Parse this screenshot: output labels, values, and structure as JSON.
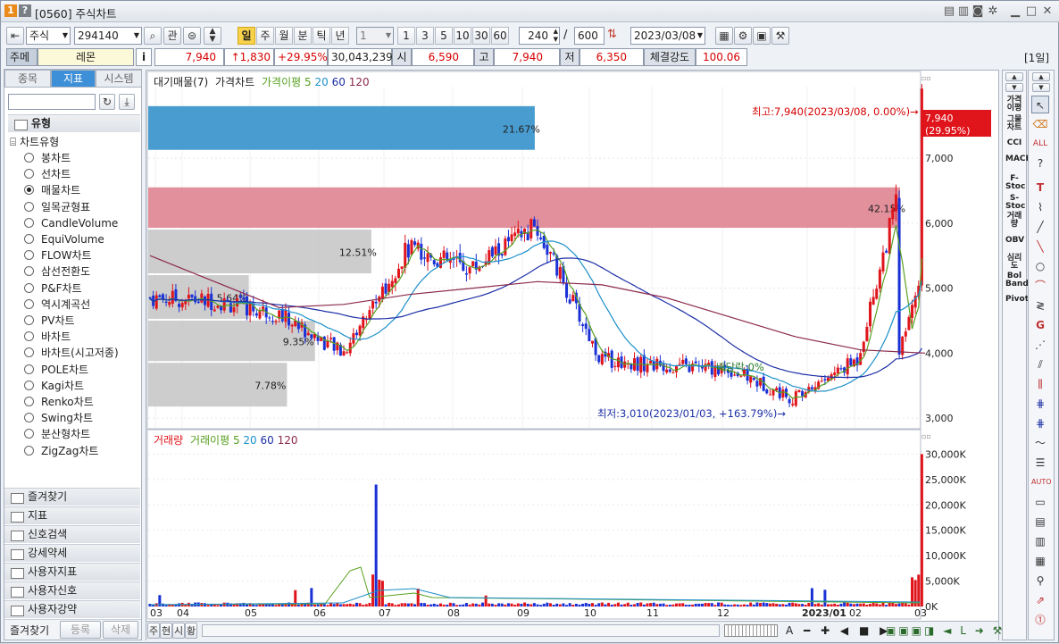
{
  "window": {
    "badge1": "1",
    "badge2": "?",
    "title": "[0560] 주식차트"
  },
  "toolbar1": {
    "market": "주식",
    "code": "294140",
    "btn_gwan": "관",
    "periods": [
      "일",
      "주",
      "월",
      "분",
      "틱",
      "년"
    ],
    "period_n": "1",
    "quick_n": [
      "1",
      "3",
      "5",
      "10",
      "30",
      "60"
    ],
    "view_count": "240",
    "slash": "/",
    "total_count": "600",
    "date": "2023/03/08"
  },
  "toolbar2": {
    "stock_type": "주메",
    "stock_name": "레몬",
    "info": "i",
    "price": "7,940",
    "change": "↑1,830",
    "rate": "+29.95%",
    "volume": "30,043,239",
    "open_label": "시",
    "open": "6,590",
    "high_label": "고",
    "high": "7,940",
    "low_label": "저",
    "low": "6,350",
    "strength_label": "체결강도",
    "strength": "100.06",
    "period_tag": "[1일]"
  },
  "leftpanel": {
    "tabs": [
      "종목",
      "지표",
      "시스템"
    ],
    "section": "유형",
    "group": "차트유형",
    "chart_types": [
      "봉차트",
      "선차트",
      "매물차트",
      "일목균형표",
      "CandleVolume",
      "EquiVolume",
      "FLOW차트",
      "삼선전환도",
      "P&F차트",
      "역시계곡선",
      "PV차트",
      "바차트",
      "바차트(시고저종)",
      "POLE차트",
      "Kagi차트",
      "Renko차트",
      "Swing차트",
      "분산형차트",
      "ZigZag차트"
    ],
    "selected": "매물차트",
    "folders": [
      "즐겨찾기",
      "지표",
      "신호검색",
      "강세약세",
      "사용자지표",
      "사용자신호",
      "사용자강약"
    ],
    "bottom_buttons": [
      "즐겨찾기",
      "등록",
      "삭제"
    ]
  },
  "price_legend": {
    "vp": "대기매물(7)",
    "price": "가격차트",
    "ma_label": "가격이평",
    "ma": [
      "5",
      "20",
      "60",
      "120"
    ]
  },
  "volume_legend": {
    "vol": "거래량",
    "ma_label": "거래이평",
    "ma": [
      "5",
      "20",
      "60",
      "120"
    ]
  },
  "annotations": {
    "high": "최고:7,940(2023/03/08, 0.00%)→",
    "low": "최저:3,010(2023/01/03, +163.79%)→",
    "last_price": "7,940",
    "last_rate": "(29.95%)",
    "vp_labels": [
      "21.67%",
      "42.15%",
      "12.51%",
      "5.64%",
      "9.35%",
      "7.78%"
    ],
    "dividend": "배당락:0%"
  },
  "price_axis": [
    "7,000",
    "6,000",
    "5,000",
    "4,000",
    "3,000"
  ],
  "volume_axis": [
    "30,000K",
    "25,000K",
    "20,000K",
    "15,000K",
    "10,000K",
    "5,000K",
    "0K"
  ],
  "x_axis": [
    "03",
    "04",
    "05",
    "06",
    "07",
    "08",
    "09",
    "10",
    "11",
    "12",
    "2023/01",
    "02",
    "03"
  ],
  "bottom_bar": {
    "tabs": [
      "주",
      "현",
      "시",
      "황"
    ]
  },
  "right_tools": [
    "가격이평",
    "그물차트",
    "CCI",
    "MACD",
    "F-Stoc",
    "S-Stoc",
    "거래량",
    "OBV",
    "심리도",
    "Bol Band",
    "Pivot"
  ],
  "colors": {
    "vp_blue": "#3f97cc",
    "vp_pink": "#e08a96",
    "vp_gray": "#c8c8c8",
    "up": "#e0141b",
    "down": "#1a31d6",
    "ma5": "#57a020",
    "ma20": "#1b8fc9",
    "ma60": "#1c2fa6",
    "ma120": "#8c2a4d"
  },
  "chart_data": {
    "type": "candlestick",
    "title": "",
    "x_dates": [
      "2022/03",
      "2022/04",
      "2022/05",
      "2022/06",
      "2022/07",
      "2022/08",
      "2022/09",
      "2022/10",
      "2022/11",
      "2022/12",
      "2023/01",
      "2023/02",
      "2023/03"
    ],
    "close_approx": [
      4850,
      4800,
      4600,
      4000,
      5600,
      5300,
      5950,
      3900,
      3800,
      3750,
      3300,
      3900,
      7940
    ],
    "ma120_approx": [
      5500,
      5100,
      4700,
      4750,
      4900,
      5000,
      5100,
      5050,
      4850,
      4550,
      4250,
      4050,
      4000
    ],
    "high": {
      "value": 7940,
      "date": "2023/03/08"
    },
    "low": {
      "value": 3010,
      "date": "2023/01/03"
    },
    "volume_profile": [
      {
        "low": 7100,
        "high": 7800,
        "pct": 21.67
      },
      {
        "low": 5900,
        "high": 6550,
        "pct": 42.15
      },
      {
        "low": 5200,
        "high": 5900,
        "pct": 12.51
      },
      {
        "low": 4500,
        "high": 5200,
        "pct": 5.64
      },
      {
        "low": 3850,
        "high": 4500,
        "pct": 9.35
      },
      {
        "low": 3150,
        "high": 3850,
        "pct": 7.78
      }
    ],
    "ylim": [
      2850,
      8100
    ],
    "volume_ylim": [
      0,
      32000
    ],
    "volume_spikes": [
      {
        "month": "2022/06",
        "value": 24000
      },
      {
        "month": "2023/03",
        "value": 30000
      }
    ]
  }
}
